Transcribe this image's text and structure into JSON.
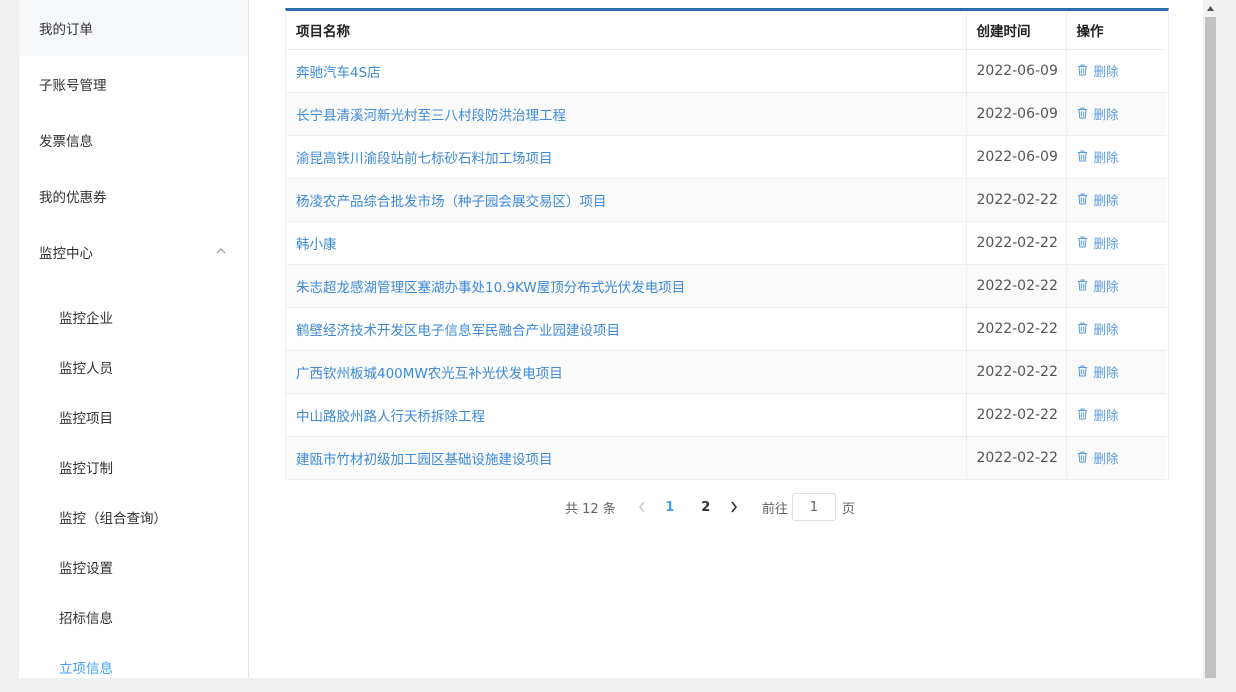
{
  "sidebar": {
    "items": [
      {
        "label": "我的订单"
      },
      {
        "label": "子账号管理"
      },
      {
        "label": "发票信息"
      },
      {
        "label": "我的优惠券"
      },
      {
        "label": "监控中心"
      }
    ],
    "submenu": [
      {
        "label": "监控企业"
      },
      {
        "label": "监控人员"
      },
      {
        "label": "监控项目"
      },
      {
        "label": "监控订制"
      },
      {
        "label": "监控（组合查询）"
      },
      {
        "label": "监控设置"
      },
      {
        "label": "招标信息"
      },
      {
        "label": "立项信息"
      }
    ]
  },
  "table": {
    "headers": {
      "name": "项目名称",
      "date": "创建时间",
      "action": "操作"
    },
    "delete_label": "删除",
    "rows": [
      {
        "name": "奔驰汽车4S店",
        "date": "2022-06-09"
      },
      {
        "name": "长宁县清溪河新光村至三八村段防洪治理工程",
        "date": "2022-06-09"
      },
      {
        "name": "渝昆高铁川渝段站前七标砂石料加工场项目",
        "date": "2022-06-09"
      },
      {
        "name": "杨凌农产品综合批发市场（种子园会展交易区）项目",
        "date": "2022-02-22"
      },
      {
        "name": "韩小康",
        "date": "2022-02-22"
      },
      {
        "name": "朱志超龙感湖管理区塞湖办事处10.9KW屋顶分布式光伏发电项目",
        "date": "2022-02-22"
      },
      {
        "name": "鹤壁经济技术开发区电子信息军民融合产业园建设项目",
        "date": "2022-02-22"
      },
      {
        "name": "广西钦州板城400MW农光互补光伏发电项目",
        "date": "2022-02-22"
      },
      {
        "name": "中山路胶州路人行天桥拆除工程",
        "date": "2022-02-22"
      },
      {
        "name": "建瓯市竹材初级加工园区基础设施建设项目",
        "date": "2022-02-22"
      }
    ]
  },
  "pagination": {
    "total_text": "共 12 条",
    "pages": [
      "1",
      "2"
    ],
    "current_page": "1",
    "goto_label": "前往",
    "goto_value": "1",
    "page_suffix": "页"
  },
  "icons": {
    "delete": "trash-icon",
    "prev": "chevron-left-icon",
    "next": "chevron-right-icon",
    "collapse": "chevron-up-icon"
  },
  "colors": {
    "accent": "#409eff",
    "link": "#3d8ad6",
    "table_top_border": "#2a6cb0"
  }
}
